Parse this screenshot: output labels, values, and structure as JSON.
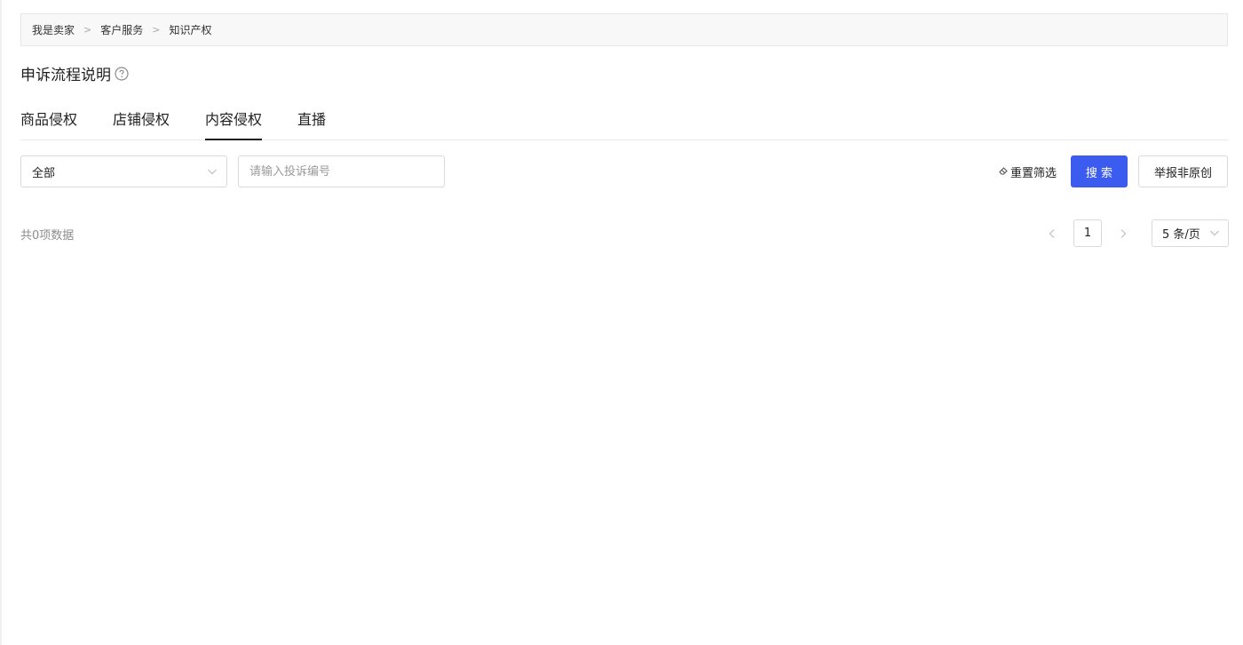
{
  "breadcrumb": {
    "items": [
      "我是卖家",
      "客户服务",
      "知识产权"
    ],
    "separator": ">"
  },
  "page": {
    "title": "申诉流程说明",
    "help_icon": "question-circle-icon"
  },
  "tabs": [
    {
      "label": "商品侵权",
      "active": false
    },
    {
      "label": "店铺侵权",
      "active": false
    },
    {
      "label": "内容侵权",
      "active": true
    },
    {
      "label": "直播",
      "active": false
    }
  ],
  "filters": {
    "type_select": {
      "value": "全部",
      "icon": "chevron-down-icon"
    },
    "search": {
      "placeholder": "请输入投诉编号",
      "value": ""
    },
    "reset_label": "重置筛选",
    "reset_icon": "eraser-icon",
    "search_button": "搜 索",
    "report_button": "举报非原创"
  },
  "list": {
    "total_text": "共0项数据"
  },
  "pagination": {
    "current_page": "1",
    "page_size": "5 条/页",
    "prev_icon": "chevron-left-icon",
    "next_icon": "chevron-right-icon"
  },
  "colors": {
    "primary": "#3c5cf0",
    "border": "#d9d9d9",
    "breadcrumb_bg": "#f8f8f8"
  }
}
